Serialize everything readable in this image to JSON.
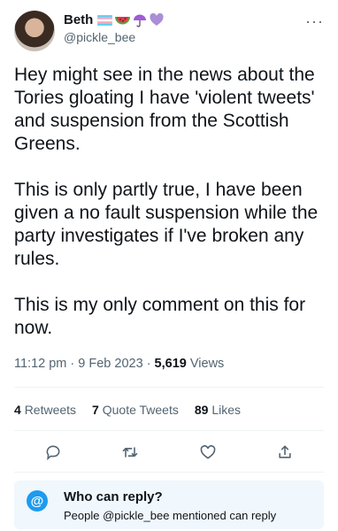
{
  "author": {
    "name": "Beth",
    "handle": "@pickle_bee",
    "emojis": [
      "trans-flag-icon",
      "watermelon-icon",
      "umbrella-icon",
      "purple-heart-icon"
    ]
  },
  "menu": {
    "more_label": "···"
  },
  "tweet": {
    "text": "Hey might see in the news about the Tories gloating I have 'violent tweets' and suspension from the Scottish Greens.\n\nThis is only partly true, I have been given a no fault suspension while the party investigates if I've broken any rules.\n\nThis is my only comment on this for now.",
    "time": "11:12 pm",
    "date": "9 Feb 2023",
    "views_count": "5,619",
    "views_label": "Views"
  },
  "stats": {
    "retweets_count": "4",
    "retweets_label": "Retweets",
    "quotes_count": "7",
    "quotes_label": "Quote Tweets",
    "likes_count": "89",
    "likes_label": "Likes"
  },
  "actions": [
    "reply-icon",
    "retweet-icon",
    "like-icon",
    "share-icon"
  ],
  "reply_settings": {
    "icon_text": "@",
    "title": "Who can reply?",
    "subtitle": "People @pickle_bee mentioned can reply"
  },
  "colors": {
    "accent": "#1d9bf0",
    "text": "#0f1419",
    "secondary": "#536471",
    "reply_box_bg": "#f0f7fd"
  }
}
